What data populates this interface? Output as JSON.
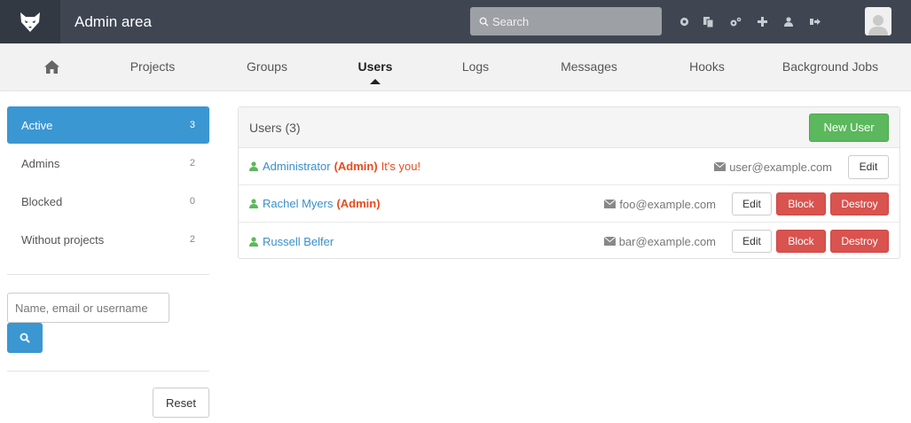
{
  "header": {
    "title": "Admin area",
    "search_placeholder": "Search",
    "icons": [
      "globe-icon",
      "copy-icon",
      "cogs-icon",
      "plus-icon",
      "user-icon",
      "sign-out-icon"
    ]
  },
  "nav": {
    "home_icon": "home-icon",
    "items": [
      "Projects",
      "Groups",
      "Users",
      "Logs",
      "Messages",
      "Hooks",
      "Background Jobs"
    ],
    "active": "Users"
  },
  "sidebar": {
    "filters": [
      {
        "label": "Active",
        "count": "3"
      },
      {
        "label": "Admins",
        "count": "2"
      },
      {
        "label": "Blocked",
        "count": "0"
      },
      {
        "label": "Without projects",
        "count": "2"
      }
    ],
    "search_placeholder": "Name, email or username",
    "reset_label": "Reset"
  },
  "panel": {
    "title": "Users (3)",
    "new_user_label": "New User",
    "users": [
      {
        "name": "Administrator",
        "admin": "(Admin)",
        "note": "It's you!",
        "email": "user@example.com",
        "edit": "Edit"
      },
      {
        "name": "Rachel Myers",
        "admin": "(Admin)",
        "note": "",
        "email": "foo@example.com",
        "edit": "Edit",
        "block": "Block",
        "destroy": "Destroy"
      },
      {
        "name": "Russell Belfer",
        "admin": "",
        "note": "",
        "email": "bar@example.com",
        "edit": "Edit",
        "block": "Block",
        "destroy": "Destroy"
      }
    ]
  },
  "colors": {
    "header_bg": "#3f4652",
    "accent_blue": "#3a97d2",
    "success_green": "#5cb85c",
    "danger_red": "#d9534f",
    "admin_orange": "#e74c1f",
    "link_blue": "#3a8fc8"
  }
}
